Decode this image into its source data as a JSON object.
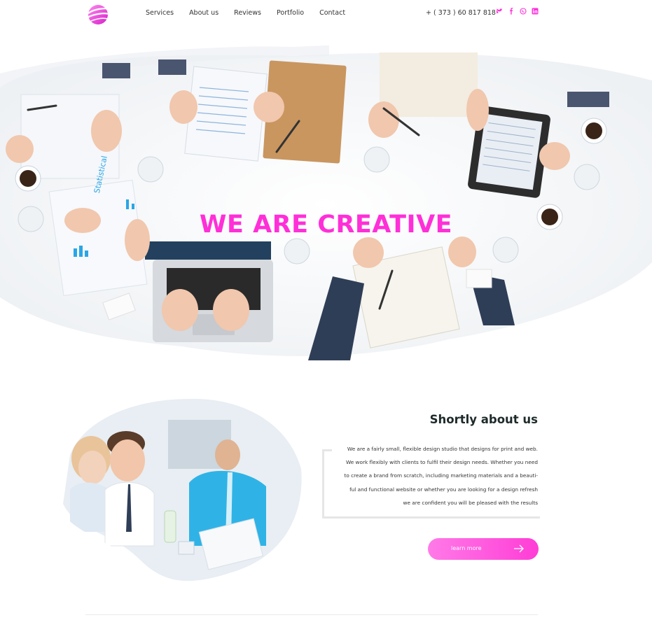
{
  "nav": {
    "items": [
      "Services",
      "About us",
      "Reviews",
      "Portfolio",
      "Contact"
    ],
    "phone": "+ ( 373 ) 60 817 818",
    "socials": [
      "twitter-icon",
      "facebook-icon",
      "whatsapp-icon",
      "linkedin-icon"
    ]
  },
  "hero": {
    "title": "WE ARE CREATIVE"
  },
  "about": {
    "title": "Shortly about us",
    "lines": [
      "We are a fairly small, flexible design studio that designs for print and web.",
      "We work flexibly with clients to fulfil their design needs. Whether you need",
      "to create a brand from scratch, including marketing materials and a beauti-",
      "ful and functional website or whether you are looking for a design refresh",
      "we are confident you will be pleased with the results"
    ],
    "button_label": "learn more"
  },
  "colors": {
    "accent": "#ff2fd8",
    "accent_light": "#ff7ae8",
    "dark_text": "#1e2a2a"
  }
}
